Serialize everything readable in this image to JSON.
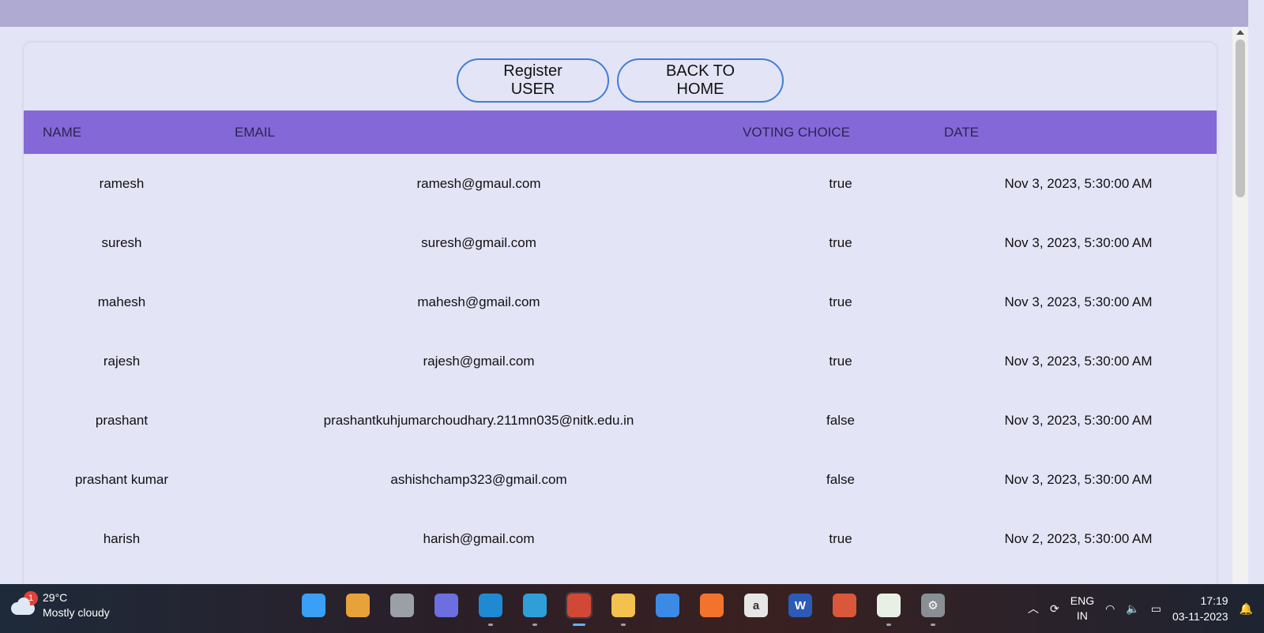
{
  "buttons": {
    "register": "Register USER",
    "home": "BACK TO HOME"
  },
  "table": {
    "headers": {
      "name": "NAME",
      "email": "EMAIL",
      "vote": "VOTING CHOICE",
      "date": "DATE"
    },
    "rows": [
      {
        "name": "ramesh",
        "email": "ramesh@gmaul.com",
        "vote": "true",
        "date": "Nov 3, 2023, 5:30:00 AM"
      },
      {
        "name": "suresh",
        "email": "suresh@gmail.com",
        "vote": "true",
        "date": "Nov 3, 2023, 5:30:00 AM"
      },
      {
        "name": "mahesh",
        "email": "mahesh@gmail.com",
        "vote": "true",
        "date": "Nov 3, 2023, 5:30:00 AM"
      },
      {
        "name": "rajesh",
        "email": "rajesh@gmail.com",
        "vote": "true",
        "date": "Nov 3, 2023, 5:30:00 AM"
      },
      {
        "name": "prashant",
        "email": "prashantkuhjumarchoudhary.211mn035@nitk.edu.in",
        "vote": "false",
        "date": "Nov 3, 2023, 5:30:00 AM"
      },
      {
        "name": "prashant kumar",
        "email": "ashishchamp323@gmail.com",
        "vote": "false",
        "date": "Nov 3, 2023, 5:30:00 AM"
      },
      {
        "name": "harish",
        "email": "harish@gmail.com",
        "vote": "true",
        "date": "Nov 2, 2023, 5:30:00 AM"
      }
    ]
  },
  "taskbar": {
    "weather": {
      "badge": "1",
      "temp": "29°C",
      "desc": "Mostly cloudy",
      "icon": "cloud-icon"
    },
    "apps": [
      {
        "name": "windows-start-icon",
        "glyph": "",
        "color": "#3aa0f5",
        "running": false,
        "active": false
      },
      {
        "name": "copilot-icon",
        "glyph": "",
        "color": "#e8a23a",
        "running": false,
        "active": false
      },
      {
        "name": "task-view-icon",
        "glyph": "",
        "color": "#9aa0a6",
        "running": false,
        "active": false
      },
      {
        "name": "teams-chat-icon",
        "glyph": "",
        "color": "#6b6fe0",
        "running": false,
        "active": false
      },
      {
        "name": "vscode-icon",
        "glyph": "",
        "color": "#1f8ad2",
        "running": true,
        "active": false
      },
      {
        "name": "edge-icon",
        "glyph": "",
        "color": "#2f9fd8",
        "running": true,
        "active": false
      },
      {
        "name": "chrome-icon",
        "glyph": "",
        "color": "#d14836",
        "running": true,
        "active": true
      },
      {
        "name": "file-explorer-icon",
        "glyph": "",
        "color": "#f2c14e",
        "running": true,
        "active": false
      },
      {
        "name": "microsoft-store-icon",
        "glyph": "",
        "color": "#3b8ae6",
        "running": false,
        "active": false
      },
      {
        "name": "firefox-icon",
        "glyph": "",
        "color": "#f2742c",
        "running": false,
        "active": false
      },
      {
        "name": "amazon-icon",
        "glyph": "a",
        "color": "#e6e6e6",
        "running": false,
        "active": false
      },
      {
        "name": "word-icon",
        "glyph": "W",
        "color": "#2b5bb5",
        "running": false,
        "active": false
      },
      {
        "name": "git-icon",
        "glyph": "",
        "color": "#d9583c",
        "running": false,
        "active": false
      },
      {
        "name": "mongodb-compass-icon",
        "glyph": "",
        "color": "#e8f0e6",
        "running": true,
        "active": false
      },
      {
        "name": "settings-icon",
        "glyph": "⚙",
        "color": "#8a8f96",
        "running": true,
        "active": false
      }
    ],
    "tray": {
      "lang1": "ENG",
      "lang2": "IN",
      "time": "17:19",
      "date": "03-11-2023"
    }
  }
}
